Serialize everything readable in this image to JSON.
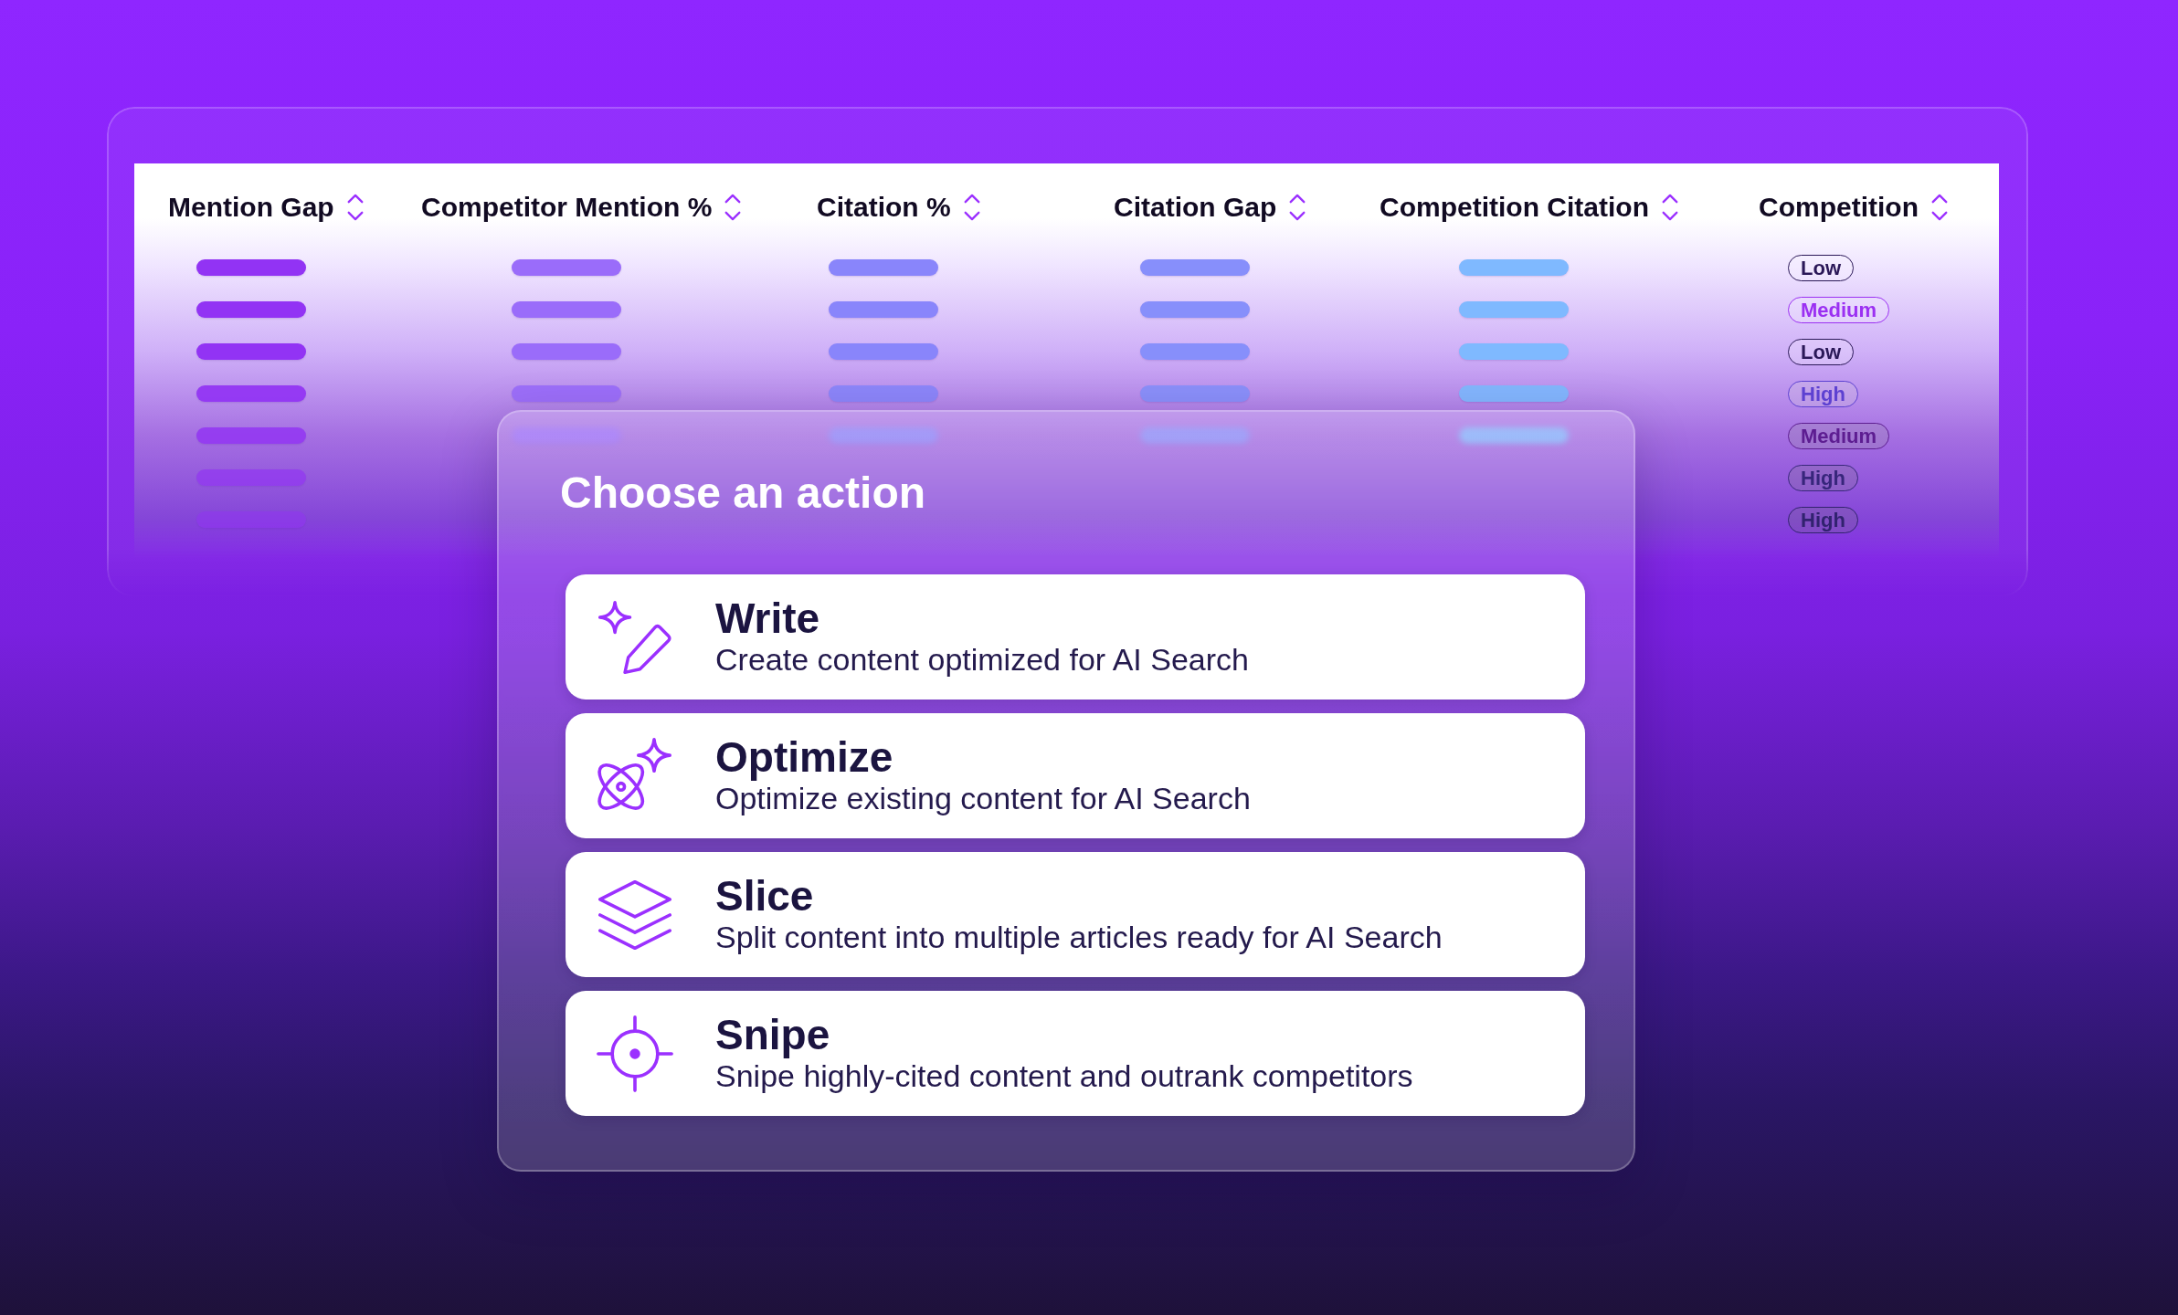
{
  "table": {
    "columns": [
      {
        "label": "Mention Gap",
        "kind": "bar"
      },
      {
        "label": "Competitor Mention %",
        "kind": "bar"
      },
      {
        "label": "Citation %",
        "kind": "bar"
      },
      {
        "label": "Citation Gap",
        "kind": "bar"
      },
      {
        "label": "Competition Citation",
        "kind": "bar"
      },
      {
        "label": "Competition",
        "kind": "badge"
      }
    ],
    "rows": [
      {
        "competition": "Low",
        "kind": "low"
      },
      {
        "competition": "Medium",
        "kind": "medium"
      },
      {
        "competition": "Low",
        "kind": "low"
      },
      {
        "competition": "High",
        "kind": "high"
      },
      {
        "competition": "Medium",
        "kind": "medium"
      },
      {
        "competition": "High",
        "kind": "high"
      },
      {
        "competition": "High",
        "kind": "high"
      }
    ]
  },
  "dialog": {
    "title": "Choose an action",
    "actions": [
      {
        "kind": "write",
        "title": "Write",
        "description": "Create content optimized for AI Search"
      },
      {
        "kind": "optimize",
        "title": "Optimize",
        "description": "Optimize existing content for AI Search"
      },
      {
        "kind": "slice",
        "title": "Slice",
        "description": "Split content into multiple articles ready for AI Search"
      },
      {
        "kind": "snipe",
        "title": "Snipe",
        "description": "Snipe highly-cited content and outrank competitors"
      }
    ]
  }
}
